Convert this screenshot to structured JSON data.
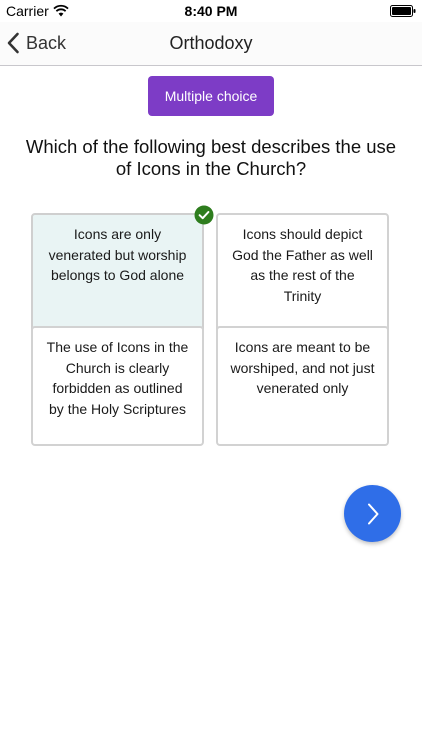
{
  "status_bar": {
    "carrier": "Carrier",
    "time": "8:40 PM",
    "icons": [
      "wifi-icon",
      "battery-icon"
    ]
  },
  "nav": {
    "back_label": "Back",
    "back_icon": "chevron-left-icon",
    "title": "Orthodoxy"
  },
  "question_type": "Multiple choice",
  "question": "Which of the following best describes the use of Icons in the Church?",
  "answers": [
    {
      "text": "Icons are only venerated but worship belongs to God alone",
      "selected": true
    },
    {
      "text": "Icons should depict God the Father as well as the rest of the Trinity",
      "selected": false
    },
    {
      "text": "The use of Icons in the Church is clearly forbidden as outlined by the Holy Scriptures",
      "selected": false
    },
    {
      "text": "Icons are meant to be worshiped, and not just venerated only",
      "selected": false
    }
  ],
  "selected_indicator_icon": "checkmark-icon",
  "next_button_icon": "chevron-right-icon",
  "colors": {
    "badge": "#7d3cc6",
    "selected_answer_bg": "#e9f4f4",
    "check_badge": "#2e7d1e",
    "next_button": "#2f6ee8"
  }
}
